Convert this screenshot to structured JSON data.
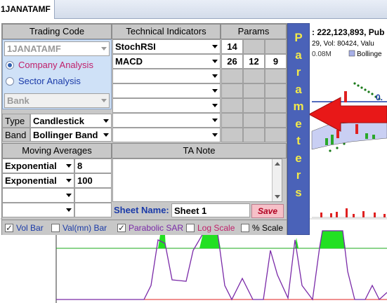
{
  "tab": {
    "label": "1JANATAMF"
  },
  "chart_header": {
    "line1": ": 222,123,893, Pub",
    "line2": "29, Vol: 80424, Valu",
    "volume_label": "0.08M",
    "legend_label": "Bollinge",
    "price_fragment": "0."
  },
  "panel": {
    "trading_code_header": "Trading Code",
    "technical_indicators_header": "Technical Indicators",
    "params_header": "Params",
    "trading_code_value": "1JANATAMF",
    "company_analysis_label": "Company Analysis",
    "sector_analysis_label": "Sector Analysis",
    "sector_value": "Bank",
    "indicators": [
      {
        "name": "StochRSI",
        "params": [
          "14",
          "",
          ""
        ]
      },
      {
        "name": "MACD",
        "params": [
          "26",
          "12",
          "9"
        ]
      },
      {
        "name": "",
        "params": [
          "",
          "",
          ""
        ]
      },
      {
        "name": "",
        "params": [
          "",
          "",
          ""
        ]
      },
      {
        "name": "",
        "params": [
          "",
          "",
          ""
        ]
      },
      {
        "name": "",
        "params": [
          "",
          "",
          ""
        ]
      },
      {
        "name": "",
        "params": [
          "",
          "",
          ""
        ]
      }
    ],
    "type_label": "Type",
    "type_value": "Candlestick",
    "band_label": "Band",
    "band_value": "Bollinger Band",
    "moving_averages_header": "Moving Averages",
    "ta_note_header": "TA Note",
    "moving_averages": [
      {
        "type": "Exponential",
        "period": "8"
      },
      {
        "type": "Exponential",
        "period": "100"
      },
      {
        "type": "",
        "period": ""
      },
      {
        "type": "",
        "period": ""
      }
    ],
    "sheet_name_label": "Sheet Name:",
    "sheet_name_value": "Sheet 1",
    "save_label": "Save",
    "checks": [
      {
        "label": "Vol Bar",
        "checked": true,
        "color": "#1a3aa8"
      },
      {
        "label": "Val(mn) Bar",
        "checked": false,
        "color": "#1a3aa8"
      },
      {
        "label": "Parabolic SAR",
        "checked": true,
        "color": "#7a2aa8"
      },
      {
        "label": "Log Scale",
        "checked": false,
        "color": "#c0206a"
      },
      {
        "label": "% Scale",
        "checked": false,
        "color": "#000000"
      }
    ]
  },
  "parameters_tab": {
    "letters": [
      "P",
      "a",
      "r",
      "a",
      "m",
      "e",
      "t",
      "e",
      "r",
      "s"
    ]
  },
  "colors": {
    "panel_bg": "#c8c8c8",
    "params_tab": "#4a62b8",
    "params_text": "#f2e94a",
    "company_analysis": "#c0206a",
    "sector_analysis": "#1a3aa8",
    "annotation_arrow": "#e81818"
  }
}
